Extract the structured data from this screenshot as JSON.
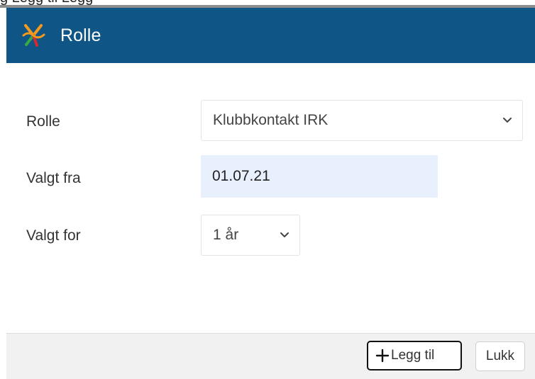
{
  "top_fragment": "g Legg til Legg",
  "dialog": {
    "title": "Rolle",
    "icon": "club-logo-icon"
  },
  "form": {
    "role": {
      "label": "Rolle",
      "value": "Klubbkontakt IRK"
    },
    "selected_from": {
      "label": "Valgt fra",
      "value": "01.07.21"
    },
    "selected_for": {
      "label": "Valgt for",
      "value": "1 år"
    }
  },
  "footer": {
    "add_label": "Legg til",
    "close_label": "Lukk"
  },
  "colors": {
    "header": "#0f5585",
    "date_input_bg": "#e8f0fe",
    "footer_bg": "#f1f1f1",
    "logo_orange": "#f39a1e",
    "logo_green": "#3aa845",
    "logo_red": "#d7282f"
  }
}
